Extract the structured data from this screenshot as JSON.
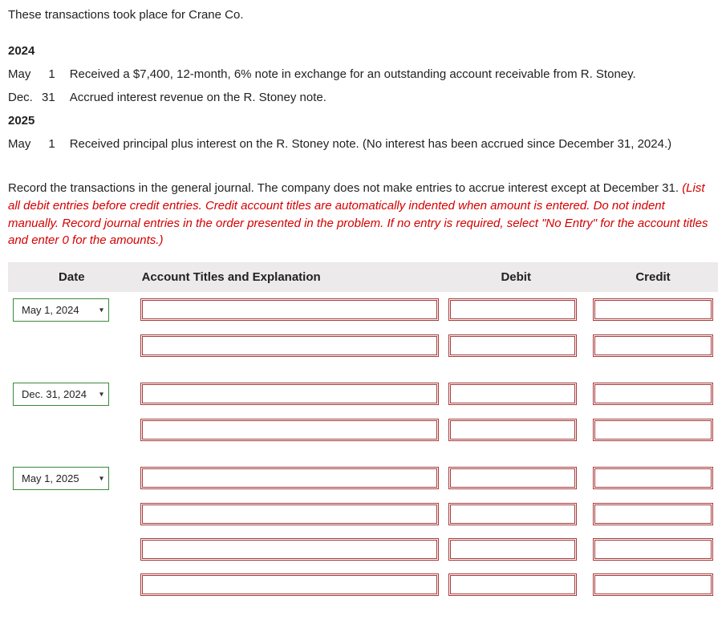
{
  "intro": "These transactions took place for Crane Co.",
  "transactions": {
    "year1": "2024",
    "r1": {
      "month": "May",
      "day": "1",
      "desc": "Received a $7,400, 12-month, 6% note in exchange for an outstanding account receivable from R. Stoney."
    },
    "r2": {
      "month": "Dec.",
      "day": "31",
      "desc": "Accrued interest revenue on the R. Stoney note."
    },
    "year2": "2025",
    "r3": {
      "month": "May",
      "day": "1",
      "desc": "Received principal plus interest on the R. Stoney note. (No interest has been accrued since December 31, 2024.)"
    }
  },
  "instructions": {
    "plain": "Record the transactions in the general journal. The company does not make entries to accrue interest except at December 31. ",
    "red": "(List all debit entries before credit entries. Credit account titles are automatically indented when amount is entered. Do not indent manually. Record journal entries in the order presented in the problem. If no entry is required, select \"No Entry\" for the account titles and enter 0 for the amounts.)"
  },
  "headers": {
    "date": "Date",
    "account": "Account Titles and Explanation",
    "debit": "Debit",
    "credit": "Credit"
  },
  "dates": {
    "d1": "May 1, 2024",
    "d2": "Dec. 31, 2024",
    "d3": "May 1, 2025"
  }
}
